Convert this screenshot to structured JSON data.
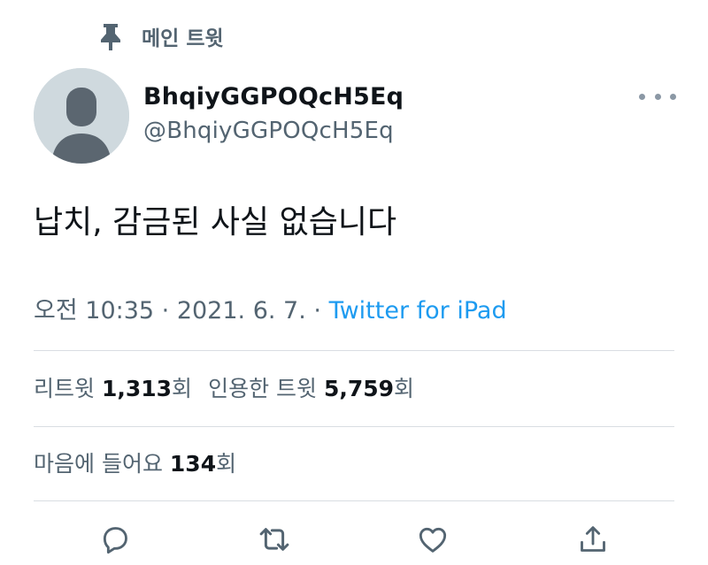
{
  "pinned": {
    "label": "메인 트윗",
    "icon": "pin-icon"
  },
  "author": {
    "name": "BhqiyGGPOQcH5Eq",
    "handle": "@BhqiyGGPOQcH5Eq",
    "avatar": "default-avatar"
  },
  "tweet": {
    "text": "납치, 감금된 사실 없습니다"
  },
  "meta": {
    "time": "오전 10:35",
    "sep1": " · ",
    "date": "2021. 6. 7.",
    "sep2": " · ",
    "source": "Twitter for iPad"
  },
  "stats": {
    "retweets": {
      "label": "리트윗",
      "count": "1,313",
      "suffix": "회"
    },
    "quotes": {
      "label": "인용한 트윗",
      "count": "5,759",
      "suffix": "회"
    },
    "likes": {
      "label": "마음에 들어요",
      "count": "134",
      "suffix": "회"
    }
  },
  "actions": [
    "reply-icon",
    "retweet-icon",
    "like-icon",
    "share-icon"
  ],
  "colors": {
    "accent": "#1d9bf0",
    "secondary_text": "#536471",
    "primary_text": "#0f1419",
    "divider": "#d9dde2"
  }
}
